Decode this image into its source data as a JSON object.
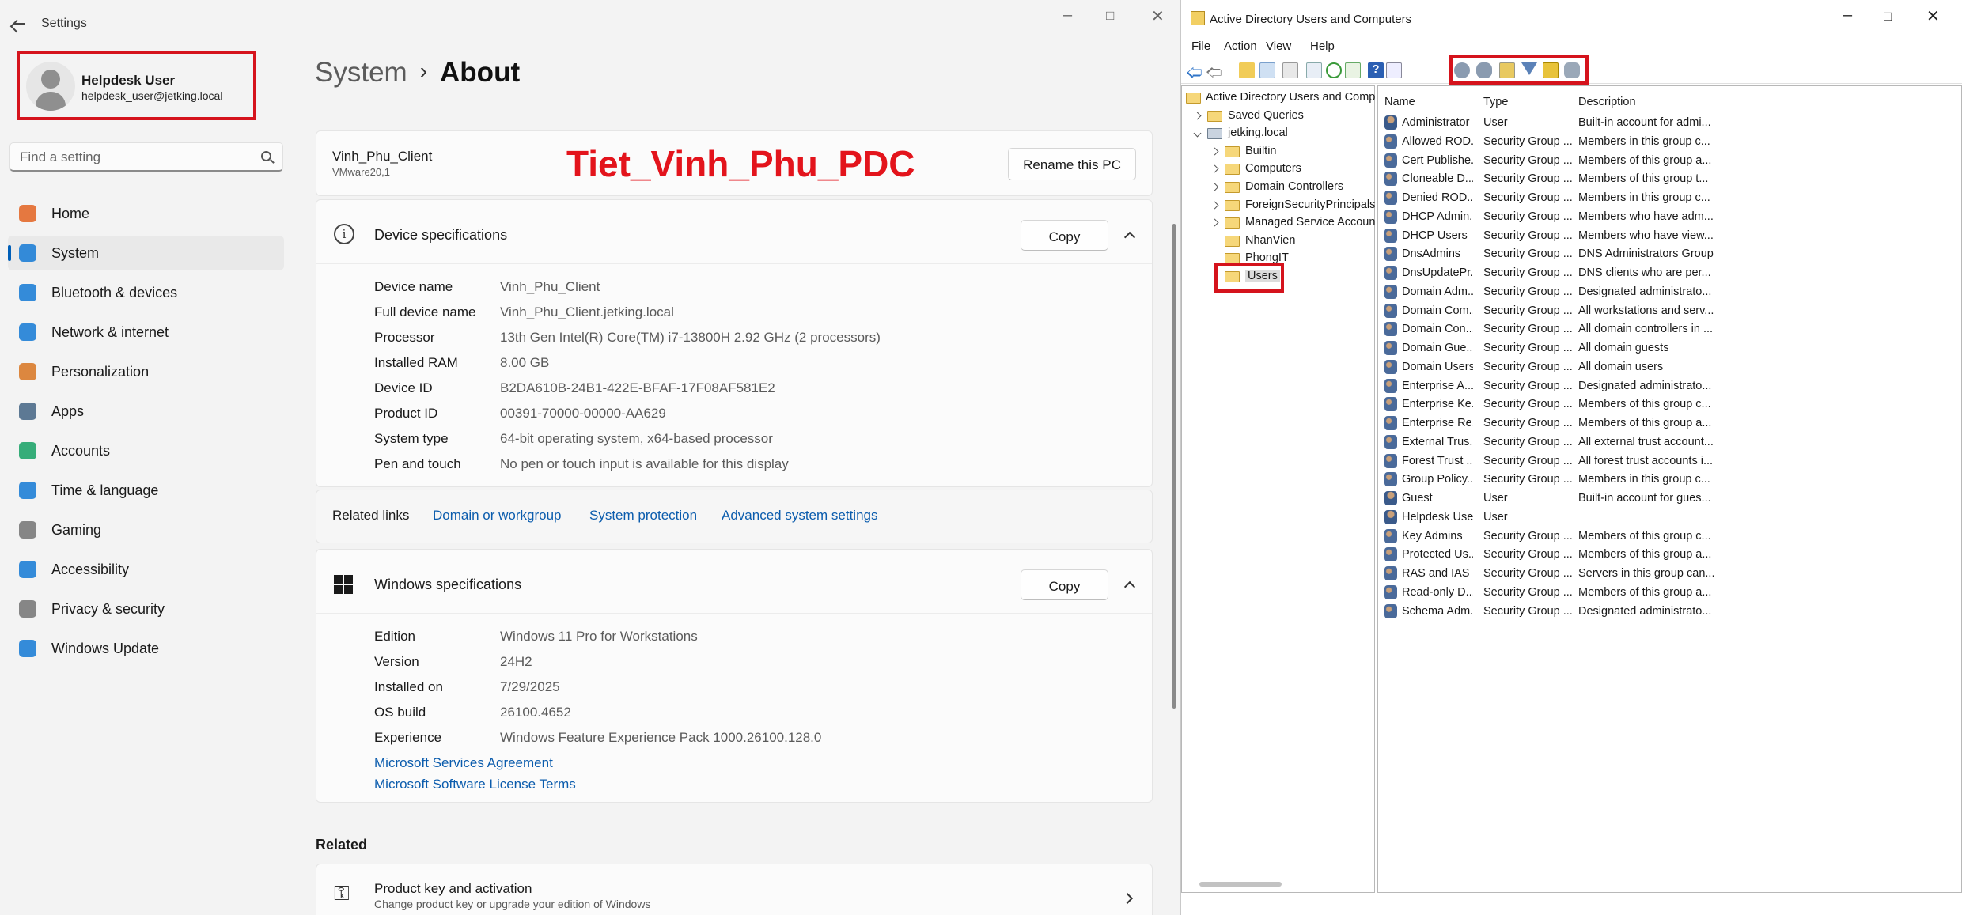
{
  "settings": {
    "app_title": "Settings",
    "profile": {
      "name": "Helpdesk User",
      "email": "helpdesk_user@jetking.local"
    },
    "search_placeholder": "Find a setting",
    "nav": [
      {
        "label": "Home",
        "icon": "home-icon",
        "color": "#e36a2c"
      },
      {
        "label": "System",
        "icon": "system-icon",
        "color": "#1f7fd6",
        "selected": true
      },
      {
        "label": "Bluetooth & devices",
        "icon": "bluetooth-icon",
        "color": "#1f7fd6"
      },
      {
        "label": "Network & internet",
        "icon": "wifi-icon",
        "color": "#1f7fd6"
      },
      {
        "label": "Personalization",
        "icon": "brush-icon",
        "color": "#d97b2b"
      },
      {
        "label": "Apps",
        "icon": "apps-icon",
        "color": "#4d6b8a"
      },
      {
        "label": "Accounts",
        "icon": "accounts-icon",
        "color": "#21a56b"
      },
      {
        "label": "Time & language",
        "icon": "globe-clock-icon",
        "color": "#1f7fd6"
      },
      {
        "label": "Gaming",
        "icon": "gamepad-icon",
        "color": "#7a7a7a"
      },
      {
        "label": "Accessibility",
        "icon": "accessibility-icon",
        "color": "#1f7fd6"
      },
      {
        "label": "Privacy & security",
        "icon": "shield-icon",
        "color": "#7a7a7a"
      },
      {
        "label": "Windows Update",
        "icon": "update-icon",
        "color": "#1f7fd6"
      }
    ],
    "breadcrumb": {
      "parent": "System",
      "current": "About"
    },
    "pc": {
      "name": "Vinh_Phu_Client",
      "model": "VMware20,1",
      "rename_label": "Rename this PC"
    },
    "watermark": "Tiet_Vinh_Phu_PDC",
    "device_specs": {
      "title": "Device specifications",
      "copy_label": "Copy",
      "rows": [
        {
          "k": "Device name",
          "v": "Vinh_Phu_Client"
        },
        {
          "k": "Full device name",
          "v": "Vinh_Phu_Client.jetking.local"
        },
        {
          "k": "Processor",
          "v": "13th Gen Intel(R) Core(TM) i7-13800H   2.92 GHz  (2 processors)"
        },
        {
          "k": "Installed RAM",
          "v": "8.00 GB"
        },
        {
          "k": "Device ID",
          "v": "B2DA610B-24B1-422E-BFAF-17F08AF581E2"
        },
        {
          "k": "Product ID",
          "v": "00391-70000-00000-AA629"
        },
        {
          "k": "System type",
          "v": "64-bit operating system, x64-based processor"
        },
        {
          "k": "Pen and touch",
          "v": "No pen or touch input is available for this display"
        }
      ]
    },
    "related_links": {
      "label": "Related links",
      "links": [
        "Domain or workgroup",
        "System protection",
        "Advanced system settings"
      ]
    },
    "windows_specs": {
      "title": "Windows specifications",
      "copy_label": "Copy",
      "rows": [
        {
          "k": "Edition",
          "v": "Windows 11 Pro for Workstations"
        },
        {
          "k": "Version",
          "v": "24H2"
        },
        {
          "k": "Installed on",
          "v": "7/29/2025"
        },
        {
          "k": "OS build",
          "v": "26100.4652"
        },
        {
          "k": "Experience",
          "v": "Windows Feature Experience Pack 1000.26100.128.0"
        }
      ],
      "links": [
        "Microsoft Services Agreement",
        "Microsoft Software License Terms"
      ]
    },
    "related": {
      "heading": "Related",
      "item_title": "Product key and activation",
      "item_sub": "Change product key or upgrade your edition of Windows"
    }
  },
  "aduc": {
    "title": "Active Directory Users and Computers",
    "menu": [
      "File",
      "Action",
      "View",
      "Help"
    ],
    "tree": [
      {
        "label": "Active Directory Users and Comp",
        "level": 0
      },
      {
        "label": "Saved Queries",
        "level": 1,
        "expander": "collapsed"
      },
      {
        "label": "jetking.local",
        "level": 1,
        "expander": "expanded"
      },
      {
        "label": "Builtin",
        "level": 2,
        "expander": "collapsed"
      },
      {
        "label": "Computers",
        "level": 2,
        "expander": "collapsed"
      },
      {
        "label": "Domain Controllers",
        "level": 2,
        "expander": "collapsed"
      },
      {
        "label": "ForeignSecurityPrincipals",
        "level": 2,
        "expander": "collapsed"
      },
      {
        "label": "Managed Service Accoun",
        "level": 2,
        "expander": "collapsed"
      },
      {
        "label": "NhanVien",
        "level": 2
      },
      {
        "label": "PhongIT",
        "level": 2
      },
      {
        "label": "Users",
        "level": 2,
        "selected": true
      }
    ],
    "columns": [
      "Name",
      "Type",
      "Description"
    ],
    "rows": [
      {
        "name": "Administrator",
        "type": "User",
        "desc": "Built-in account for admi...",
        "kind": "user"
      },
      {
        "name": "Allowed ROD...",
        "type": "Security Group ...",
        "desc": "Members in this group c...",
        "kind": "group"
      },
      {
        "name": "Cert Publishe...",
        "type": "Security Group ...",
        "desc": "Members of this group a...",
        "kind": "group"
      },
      {
        "name": "Cloneable D...",
        "type": "Security Group ...",
        "desc": "Members of this group t...",
        "kind": "group"
      },
      {
        "name": "Denied ROD...",
        "type": "Security Group ...",
        "desc": "Members in this group c...",
        "kind": "group"
      },
      {
        "name": "DHCP Admin...",
        "type": "Security Group ...",
        "desc": "Members who have adm...",
        "kind": "group"
      },
      {
        "name": "DHCP Users",
        "type": "Security Group ...",
        "desc": "Members who have view...",
        "kind": "group"
      },
      {
        "name": "DnsAdmins",
        "type": "Security Group ...",
        "desc": "DNS Administrators Group",
        "kind": "group"
      },
      {
        "name": "DnsUpdatePr...",
        "type": "Security Group ...",
        "desc": "DNS clients who are per...",
        "kind": "group"
      },
      {
        "name": "Domain Adm...",
        "type": "Security Group ...",
        "desc": "Designated administrato...",
        "kind": "group"
      },
      {
        "name": "Domain Com...",
        "type": "Security Group ...",
        "desc": "All workstations and serv...",
        "kind": "group"
      },
      {
        "name": "Domain Con...",
        "type": "Security Group ...",
        "desc": "All domain controllers in ...",
        "kind": "group"
      },
      {
        "name": "Domain Gue...",
        "type": "Security Group ...",
        "desc": "All domain guests",
        "kind": "group"
      },
      {
        "name": "Domain Users",
        "type": "Security Group ...",
        "desc": "All domain users",
        "kind": "group"
      },
      {
        "name": "Enterprise A...",
        "type": "Security Group ...",
        "desc": "Designated administrato...",
        "kind": "group"
      },
      {
        "name": "Enterprise Ke...",
        "type": "Security Group ...",
        "desc": "Members of this group c...",
        "kind": "group"
      },
      {
        "name": "Enterprise Re...",
        "type": "Security Group ...",
        "desc": "Members of this group a...",
        "kind": "group"
      },
      {
        "name": "External Trus...",
        "type": "Security Group ...",
        "desc": "All external trust account...",
        "kind": "group"
      },
      {
        "name": "Forest Trust ...",
        "type": "Security Group ...",
        "desc": "All forest trust accounts i...",
        "kind": "group"
      },
      {
        "name": "Group Policy...",
        "type": "Security Group ...",
        "desc": "Members in this group c...",
        "kind": "group"
      },
      {
        "name": "Guest",
        "type": "User",
        "desc": "Built-in account for gues...",
        "kind": "user"
      },
      {
        "name": "Helpdesk User",
        "type": "User",
        "desc": "",
        "kind": "user"
      },
      {
        "name": "Key Admins",
        "type": "Security Group ...",
        "desc": "Members of this group c...",
        "kind": "group"
      },
      {
        "name": "Protected Us...",
        "type": "Security Group ...",
        "desc": "Members of this group a...",
        "kind": "group"
      },
      {
        "name": "RAS and IAS ...",
        "type": "Security Group ...",
        "desc": "Servers in this group can...",
        "kind": "group"
      },
      {
        "name": "Read-only D...",
        "type": "Security Group ...",
        "desc": "Members of this group a...",
        "kind": "group"
      },
      {
        "name": "Schema Adm...",
        "type": "Security Group ...",
        "desc": "Designated administrato...",
        "kind": "group"
      }
    ]
  }
}
